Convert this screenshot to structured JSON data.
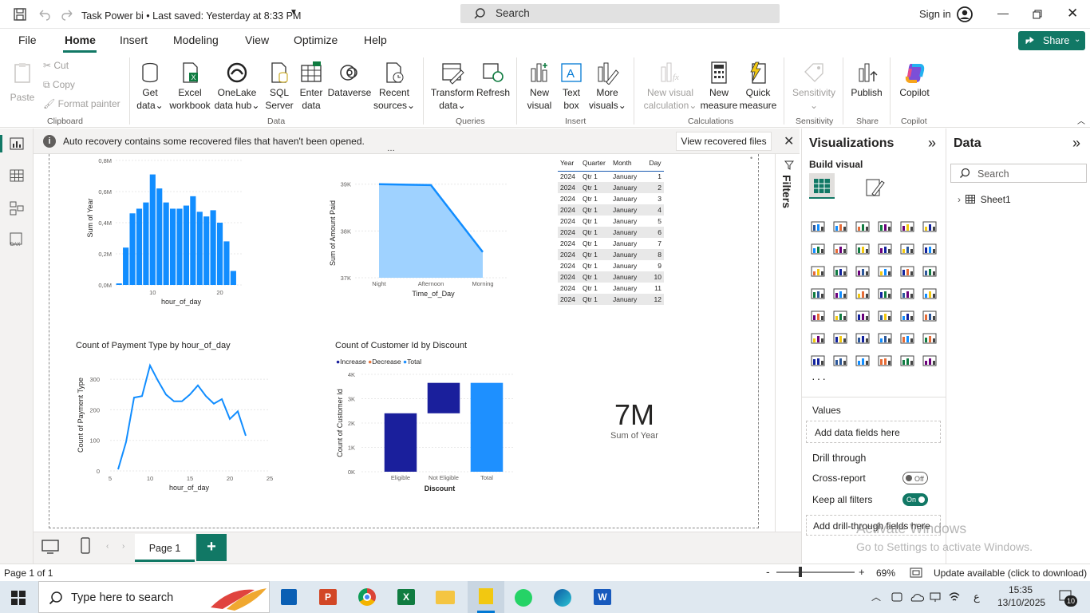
{
  "title": {
    "text": "Task Power bi • Last saved: Yesterday at 8:33 PM",
    "search": "Search",
    "signin": "Sign in"
  },
  "menu": {
    "items": [
      "File",
      "Home",
      "Insert",
      "Modeling",
      "View",
      "Optimize",
      "Help"
    ],
    "active": "Home",
    "share": "Share"
  },
  "ribbon": {
    "clipboard": {
      "paste": "Paste",
      "cut": "Cut",
      "copy": "Copy",
      "format": "Format painter",
      "label": "Clipboard"
    },
    "data": {
      "get": [
        "Get",
        "data"
      ],
      "excel": [
        "Excel",
        "workbook"
      ],
      "onelake": [
        "OneLake",
        "data hub"
      ],
      "sql": [
        "SQL",
        "Server"
      ],
      "enter": [
        "Enter",
        "data"
      ],
      "dataverse": "Dataverse",
      "recent": [
        "Recent",
        "sources"
      ],
      "label": "Data"
    },
    "queries": {
      "transform": [
        "Transform",
        "data"
      ],
      "refresh": "Refresh",
      "label": "Queries"
    },
    "insert": {
      "newvisual": [
        "New",
        "visual"
      ],
      "textbox": [
        "Text",
        "box"
      ],
      "more": [
        "More",
        "visuals"
      ],
      "label": "Insert"
    },
    "calc": {
      "newcalc": [
        "New visual",
        "calculation"
      ],
      "newmeasure": [
        "New",
        "measure"
      ],
      "quick": [
        "Quick",
        "measure"
      ],
      "label": "Calculations"
    },
    "sensitivity": {
      "btn": "Sensitivity",
      "label": "Sensitivity"
    },
    "share": {
      "publish": "Publish",
      "label": "Share"
    },
    "copilot": {
      "btn": "Copilot",
      "label": "Copilot"
    }
  },
  "notice": {
    "text": "Auto recovery contains some recovered files that haven't been opened.",
    "button": "View recovered files"
  },
  "charts": {
    "c1": {
      "ylabel": "Sum of Year",
      "xlabel": "hour_of_day"
    },
    "c2": {
      "ylabel": "Sum of Amount Paid",
      "xlabel": "Time_of_Day"
    },
    "c3": {
      "title": "Count of Payment Type by hour_of_day",
      "ylabel": "Count of Payment Type",
      "xlabel": "hour_of_day"
    },
    "c4": {
      "title": "Count of Customer Id by Discount",
      "ylabel": "Count of Customer Id",
      "xlabel": "Discount",
      "legend": [
        "Increase",
        "Decrease",
        "Total"
      ]
    },
    "card": {
      "value": "7M",
      "label": "Sum of Year"
    }
  },
  "chart_data": [
    {
      "type": "bar",
      "xlabel": "hour_of_day",
      "ylabel": "Sum of Year",
      "x": [
        5,
        6,
        7,
        8,
        9,
        10,
        11,
        12,
        13,
        14,
        15,
        16,
        17,
        18,
        19,
        20,
        21,
        22
      ],
      "values": [
        0.01,
        0.24,
        0.46,
        0.49,
        0.53,
        0.71,
        0.62,
        0.53,
        0.49,
        0.49,
        0.51,
        0.57,
        0.47,
        0.44,
        0.48,
        0.4,
        0.28,
        0.09
      ],
      "unit": "M",
      "yticks": [
        "0,0M",
        "0,2M",
        "0,4M",
        "0,6M",
        "0,8M"
      ],
      "xticks": [
        "10",
        "20"
      ],
      "ylim": [
        0,
        0.8
      ]
    },
    {
      "type": "area",
      "xlabel": "Time_of_Day",
      "ylabel": "Sum of Amount Paid",
      "categories": [
        "Night",
        "Afternoon",
        "Morning"
      ],
      "values": [
        39000,
        38980,
        37550
      ],
      "yticks": [
        "37K",
        "38K",
        "39K"
      ],
      "ylim": [
        37000,
        39200
      ]
    },
    {
      "type": "table",
      "columns": [
        "Year",
        "Quarter",
        "Month",
        "Day"
      ],
      "rows": [
        [
          "2024",
          "Qtr 1",
          "January",
          "1"
        ],
        [
          "2024",
          "Qtr 1",
          "January",
          "2"
        ],
        [
          "2024",
          "Qtr 1",
          "January",
          "3"
        ],
        [
          "2024",
          "Qtr 1",
          "January",
          "4"
        ],
        [
          "2024",
          "Qtr 1",
          "January",
          "5"
        ],
        [
          "2024",
          "Qtr 1",
          "January",
          "6"
        ],
        [
          "2024",
          "Qtr 1",
          "January",
          "7"
        ],
        [
          "2024",
          "Qtr 1",
          "January",
          "8"
        ],
        [
          "2024",
          "Qtr 1",
          "January",
          "9"
        ],
        [
          "2024",
          "Qtr 1",
          "January",
          "10"
        ],
        [
          "2024",
          "Qtr 1",
          "January",
          "11"
        ],
        [
          "2024",
          "Qtr 1",
          "January",
          "12"
        ]
      ]
    },
    {
      "type": "line",
      "title": "Count of Payment Type by hour_of_day",
      "xlabel": "hour_of_day",
      "ylabel": "Count of Payment Type",
      "x": [
        6,
        7,
        8,
        9,
        10,
        11,
        12,
        13,
        14,
        15,
        16,
        17,
        18,
        19,
        20,
        21,
        22
      ],
      "values": [
        5,
        95,
        240,
        245,
        345,
        295,
        250,
        228,
        228,
        250,
        280,
        245,
        220,
        235,
        170,
        195,
        115
      ],
      "xticks": [
        "5",
        "10",
        "15",
        "20",
        "25"
      ],
      "yticks": [
        "0",
        "100",
        "200",
        "300"
      ],
      "xlim": [
        5,
        25
      ],
      "ylim": [
        0,
        350
      ]
    },
    {
      "type": "bar",
      "subtype": "waterfall",
      "title": "Count of Customer Id by Discount",
      "xlabel": "Discount",
      "ylabel": "Count of Customer Id",
      "categories": [
        "Eligible",
        "Not Eligible",
        "Total"
      ],
      "series": [
        {
          "name": "Increase",
          "values": [
            2400,
            1250,
            null
          ]
        },
        {
          "name": "Total",
          "values": [
            null,
            null,
            3650
          ]
        }
      ],
      "legend": [
        "Increase",
        "Decrease",
        "Total"
      ],
      "yticks": [
        "0K",
        "1K",
        "2K",
        "3K",
        "4K"
      ],
      "ylim": [
        0,
        4000
      ]
    }
  ],
  "filters": {
    "label": "Filters"
  },
  "viz": {
    "title": "Visualizations",
    "build": "Build visual",
    "values": "Values",
    "add_data": "Add data fields here",
    "drill": "Drill through",
    "cross": "Cross-report",
    "cross_state": "Off",
    "keep": "Keep all filters",
    "keep_state": "On",
    "add_drill": "Add drill-through fields here"
  },
  "data": {
    "title": "Data",
    "search": "Search",
    "table": "Sheet1"
  },
  "pages": {
    "page1": "Page 1"
  },
  "status": {
    "page": "Page 1 of 1",
    "zoom": "69%",
    "update": "Update available (click to download)"
  },
  "watermark": {
    "line1": "Activate Windows",
    "line2": "Go to Settings to activate Windows."
  },
  "taskbar": {
    "search": "Type here to search",
    "time": "15:35",
    "date": "13/10/2025",
    "lang": "ع",
    "badge": "10"
  }
}
